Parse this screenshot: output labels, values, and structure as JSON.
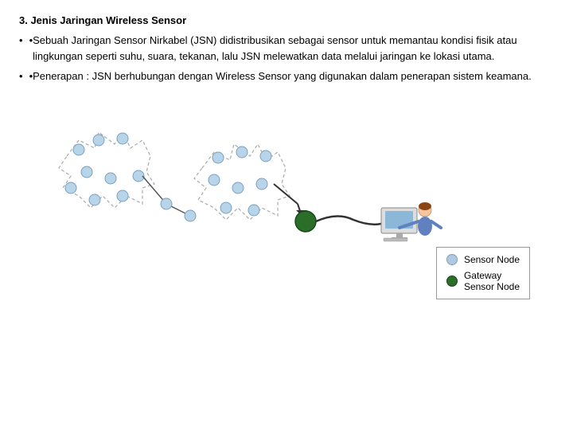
{
  "title": "3. Jenis Jaringan Wireless Sensor",
  "bullets": [
    {
      "text": "Sebuah Jaringan Sensor Nirkabel (JSN) didistribusikan sebagai sensor untuk memantau kondisi fisik atau lingkungan seperti suhu, suara, tekanan, lalu JSN melewatkan data melalui jaringan ke lokasi utama."
    },
    {
      "text": "Penerapan : JSN berhubungan dengan Wireless Sensor yang digunakan dalam penerapan sistem keamana."
    }
  ],
  "legend": {
    "sensor_node_label": "Sensor Node",
    "gateway_label": "Gateway",
    "gateway_sub": "Sensor Node"
  }
}
